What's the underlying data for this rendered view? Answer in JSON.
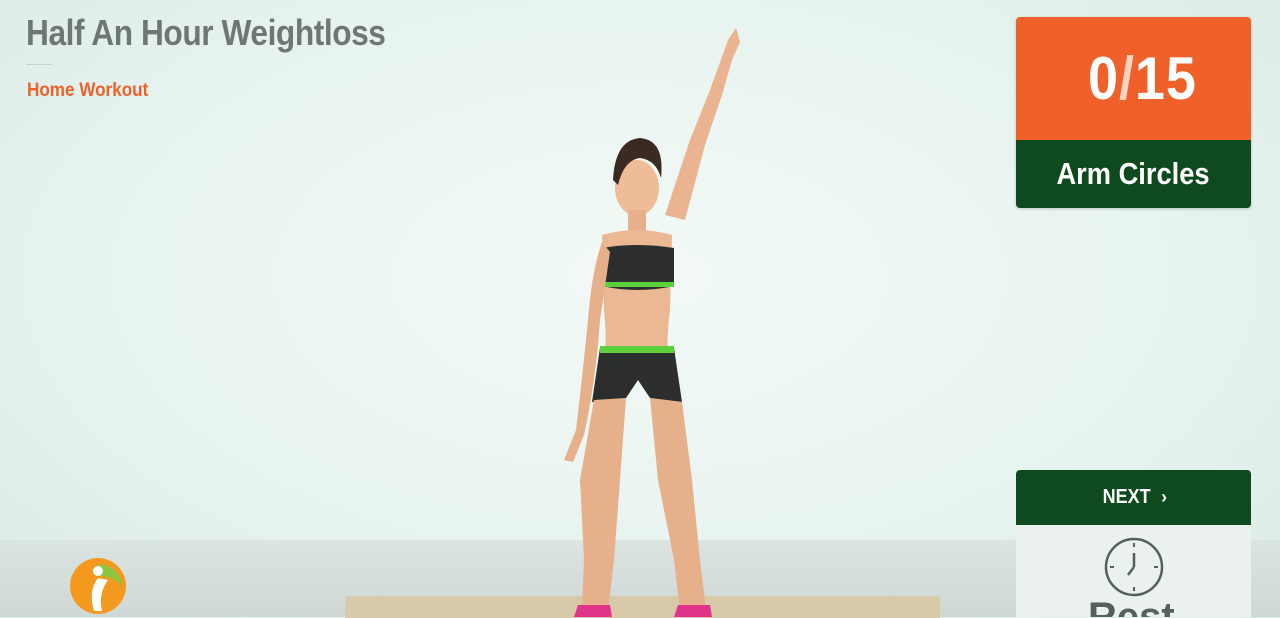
{
  "app": {
    "title": "Half An Hour Weightloss",
    "subtitle": "Home Workout"
  },
  "counter": {
    "current": "0",
    "separator": "/",
    "total": "15"
  },
  "exercise": {
    "name": "Arm Circles"
  },
  "controls": {
    "next_label": "NEXT",
    "next_icon": "chevron-right-icon",
    "rest_label": "Rest",
    "rest_icon": "clock-icon"
  },
  "colors": {
    "accent_orange": "#f0602a",
    "dark_green": "#0f4a1f",
    "title_gray": "#6f7774"
  }
}
